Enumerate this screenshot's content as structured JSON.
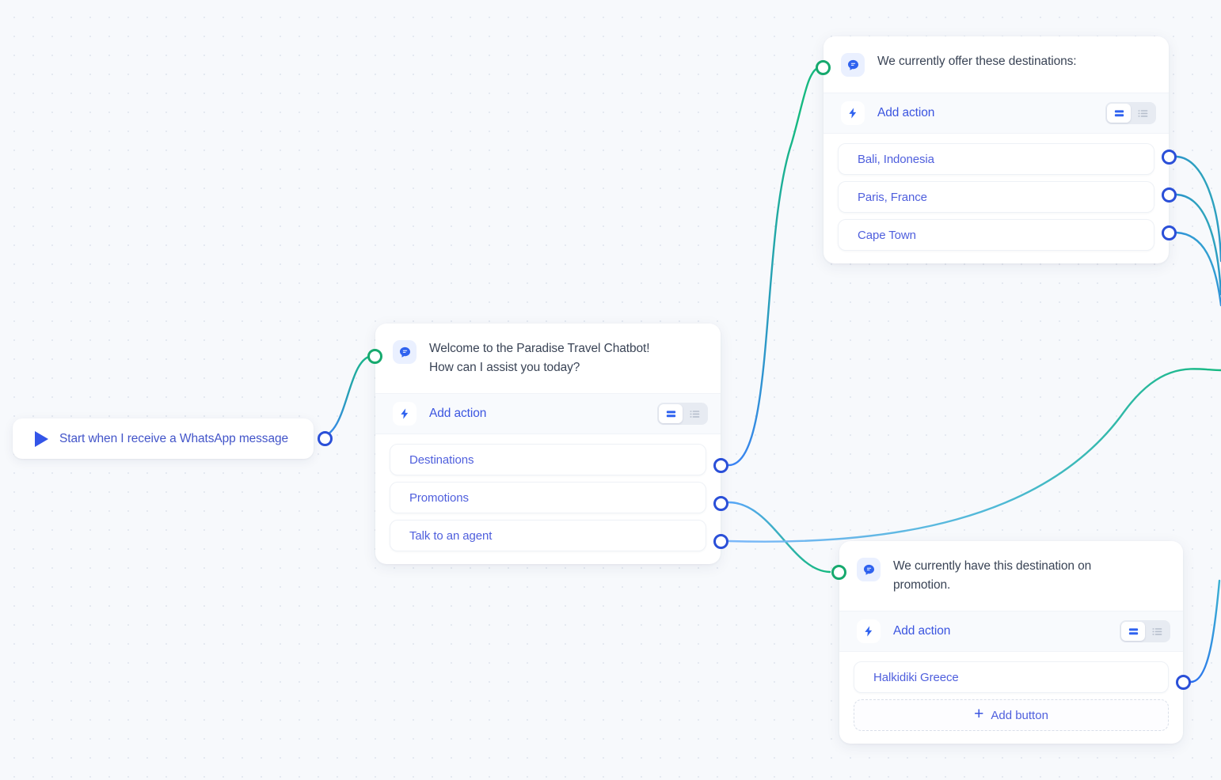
{
  "canvas": {
    "background_color": "#f7f9fc",
    "dot_color": "#e3e8f0"
  },
  "theme": {
    "accent_blue": "#3b55e0",
    "link_blue": "#4f5fdd",
    "source_handle": "#2a4fd8",
    "target_handle": "#16a96e",
    "edge_start": "#3b82f6",
    "edge_end": "#16b981",
    "text_dark": "#3a4456"
  },
  "start_node": {
    "label": "Start when I receive a WhatsApp message",
    "icon": "play-icon"
  },
  "nodes": [
    {
      "id": "welcome",
      "message": "Welcome to the Paradise Travel Chatbot! How can I assist you today?",
      "message_lines": [
        "Welcome to the Paradise Travel Chatbot!",
        "How can I assist you today?"
      ],
      "message_icon": "chat-bubble-icon",
      "action": {
        "label": "Add action",
        "icon": "lightning-bolt-icon",
        "toggle": {
          "active": "card-view",
          "options": [
            "card-view",
            "list-view"
          ]
        }
      },
      "options": [
        "Destinations",
        "Promotions",
        "Talk to an agent"
      ],
      "add_button_label": null
    },
    {
      "id": "destinations",
      "message": "We currently offer these destinations:",
      "message_lines": [
        "We currently offer these destinations:"
      ],
      "message_icon": "chat-bubble-icon",
      "action": {
        "label": "Add action",
        "icon": "lightning-bolt-icon",
        "toggle": {
          "active": "card-view",
          "options": [
            "card-view",
            "list-view"
          ]
        }
      },
      "options": [
        "Bali, Indonesia",
        "Paris, France",
        "Cape Town"
      ],
      "add_button_label": null
    },
    {
      "id": "promotion",
      "message": "We currently have this destination on promotion.",
      "message_lines": [
        "We currently have this destination on",
        "promotion."
      ],
      "message_icon": "chat-bubble-icon",
      "action": {
        "label": "Add action",
        "icon": "lightning-bolt-icon",
        "toggle": {
          "active": "card-view",
          "options": [
            "card-view",
            "list-view"
          ]
        }
      },
      "options": [
        "Halkidiki Greece"
      ],
      "add_button_label": "Add button"
    }
  ]
}
